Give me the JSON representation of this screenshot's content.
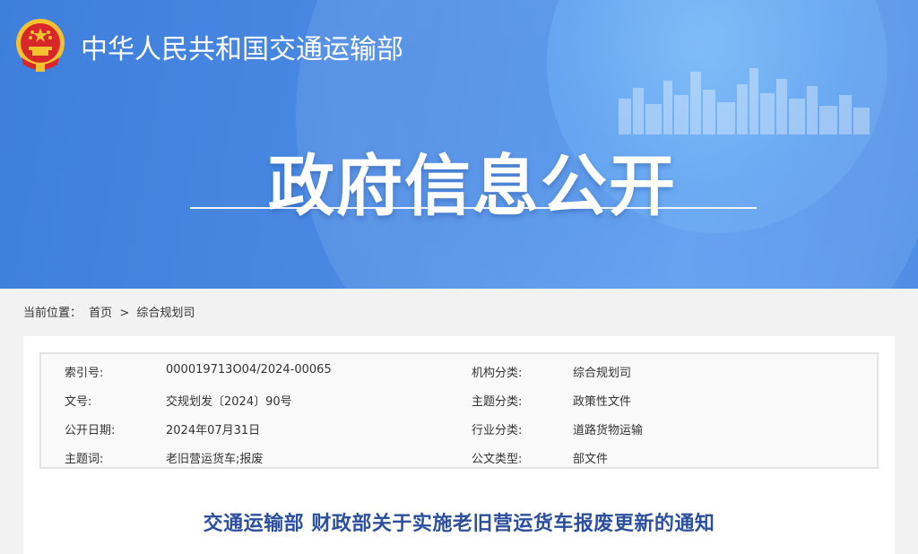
{
  "header": {
    "ministry_name": "中华人民共和国交通运输部",
    "section_title": "政府信息公开"
  },
  "breadcrumb": {
    "prefix": "当前位置：",
    "home": "首页",
    "separator": ">",
    "current": "综合规划司"
  },
  "metadata": [
    {
      "label": "索引号:",
      "value": "000019713O04/2024-00065",
      "label2": "机构分类:",
      "value2": "综合规划司"
    },
    {
      "label": "文号:",
      "value": "交规划发〔2024〕90号",
      "label2": "主题分类:",
      "value2": "政策性文件"
    },
    {
      "label": "公开日期:",
      "value": "2024年07月31日",
      "label2": "行业分类:",
      "value2": "道路货物运输"
    },
    {
      "label": "主题词:",
      "value": "老旧营运货车;报废",
      "label2": "公文类型:",
      "value2": "部文件"
    }
  ],
  "document": {
    "title": "交通运输部 财政部关于实施老旧营运货车报废更新的通知"
  },
  "colors": {
    "banner": "#4a8ae4",
    "title_blue": "#2c4f9e",
    "emblem_red": "#d8262b",
    "emblem_gold": "#f2c230"
  }
}
